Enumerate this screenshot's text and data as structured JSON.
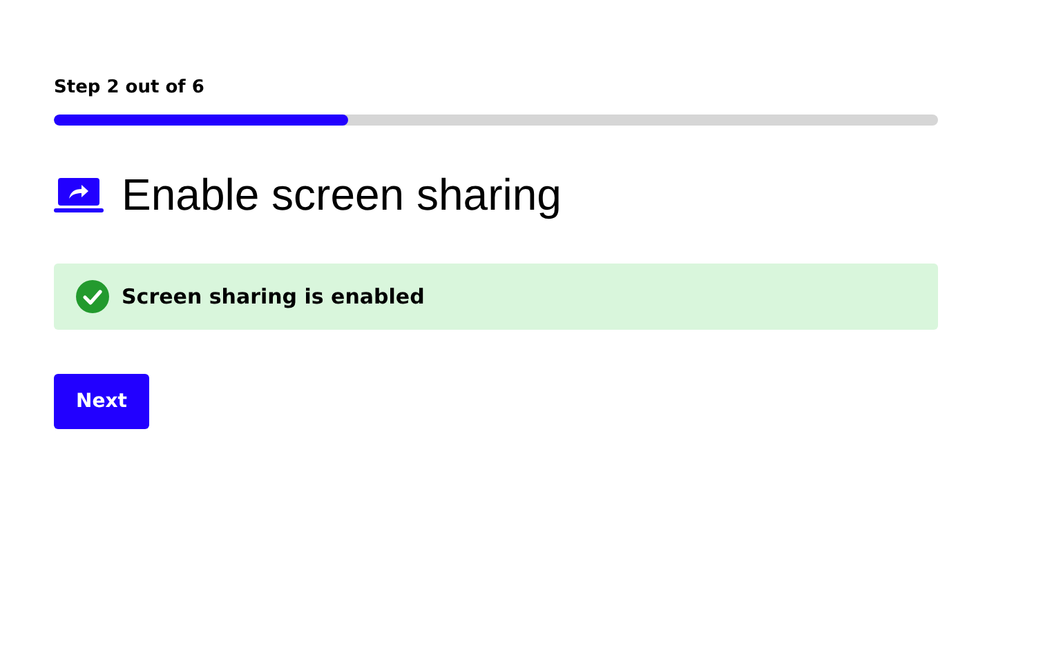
{
  "progress": {
    "label": "Step 2 out of 6",
    "level": 0.333
  },
  "heading": "Enable screen sharing",
  "alert": {
    "kind": "success",
    "text": "Screen sharing is enabled"
  },
  "buttons": [
    {
      "label": "Next"
    }
  ]
}
